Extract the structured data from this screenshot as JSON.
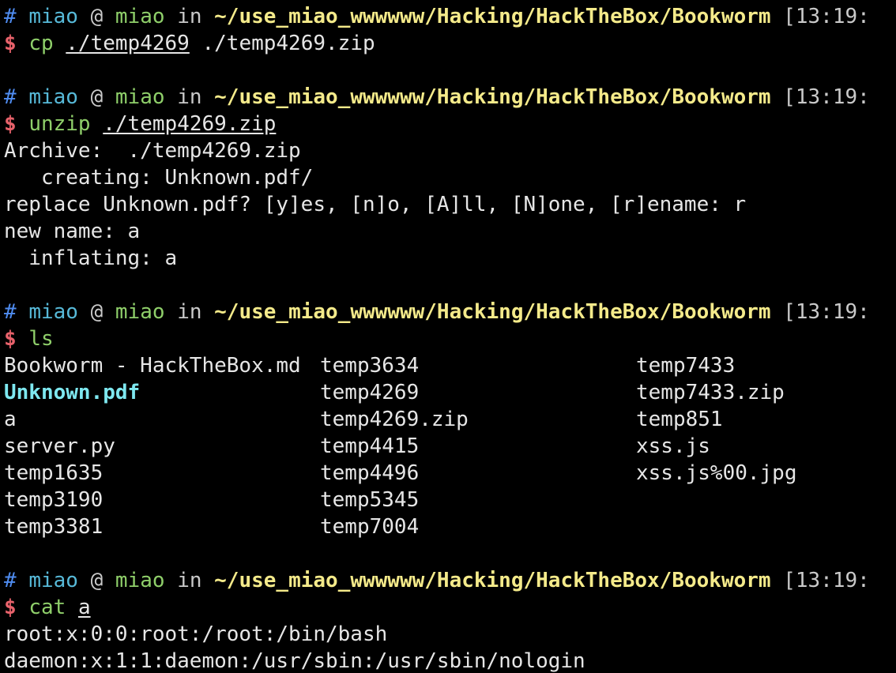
{
  "prompt": {
    "hash": "#",
    "user": "miao",
    "at": "@",
    "host": "miao",
    "in": "in",
    "path": "~/use_miao_wwwwww/Hacking/HackTheBox/Bookworm",
    "time": "[13:19:",
    "dollar": "$"
  },
  "blocks": [
    {
      "command": "cp",
      "args": [
        {
          "text": "./temp4269",
          "underline": true
        },
        {
          "text": "./temp4269.zip",
          "underline": false
        }
      ],
      "output": []
    },
    {
      "command": "unzip",
      "args": [
        {
          "text": "./temp4269.zip",
          "underline": true
        }
      ],
      "output": [
        "Archive:  ./temp4269.zip",
        "   creating: Unknown.pdf/",
        "replace Unknown.pdf? [y]es, [n]o, [A]ll, [N]one, [r]ename: r",
        "new name: a",
        "  inflating: a"
      ]
    },
    {
      "command": "ls",
      "args": [],
      "ls_columns": [
        [
          {
            "name": "Bookworm - HackTheBox.md",
            "dir": false
          },
          {
            "name": "Unknown.pdf",
            "dir": true
          },
          {
            "name": "a",
            "dir": false
          },
          {
            "name": "server.py",
            "dir": false
          },
          {
            "name": "temp1635",
            "dir": false
          },
          {
            "name": "temp3190",
            "dir": false
          },
          {
            "name": "temp3381",
            "dir": false
          }
        ],
        [
          {
            "name": "temp3634",
            "dir": false
          },
          {
            "name": "temp4269",
            "dir": false
          },
          {
            "name": "temp4269.zip",
            "dir": false
          },
          {
            "name": "temp4415",
            "dir": false
          },
          {
            "name": "temp4496",
            "dir": false
          },
          {
            "name": "temp5345",
            "dir": false
          },
          {
            "name": "temp7004",
            "dir": false
          }
        ],
        [
          {
            "name": "temp7433",
            "dir": false
          },
          {
            "name": "temp7433.zip",
            "dir": false
          },
          {
            "name": "temp851",
            "dir": false
          },
          {
            "name": "xss.js",
            "dir": false
          },
          {
            "name": "xss.js%00.jpg",
            "dir": false
          }
        ]
      ]
    },
    {
      "command": "cat",
      "args": [
        {
          "text": "a",
          "underline": true
        }
      ],
      "output": [
        "root:x:0:0:root:/root:/bin/bash",
        "daemon:x:1:1:daemon:/usr/sbin:/usr/sbin/nologin"
      ]
    }
  ],
  "colors": {
    "background": "#000000",
    "hash": "#4f8cf0",
    "user": "#57b9d8",
    "host": "#8fcf6a",
    "path": "#f4ea8a",
    "dollar": "#e8626b",
    "command": "#8fcf6a",
    "text": "#e6e6e6",
    "directory": "#7ee8f0"
  }
}
